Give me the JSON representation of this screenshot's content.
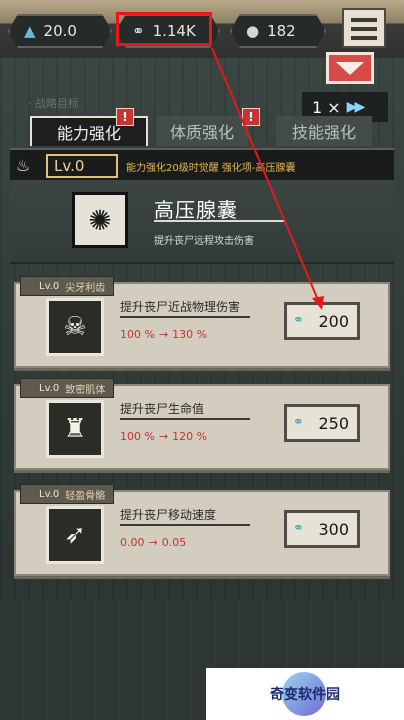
{
  "resources": {
    "rock": {
      "icon": "rock-crystal-icon",
      "value": "20.0"
    },
    "gene": {
      "icon": "gene-icon",
      "value": "1.14K"
    },
    "orb": {
      "icon": "brain-icon",
      "value": "182"
    }
  },
  "speed": {
    "label": "1 ×",
    "icon": "fast-forward-icon"
  },
  "faint_label": "· 战略目标",
  "tabs": [
    {
      "label": "能力强化",
      "active": true,
      "alert": "!"
    },
    {
      "label": "体质强化",
      "active": false,
      "alert": "!"
    },
    {
      "label": "技能强化",
      "active": false
    }
  ],
  "level": {
    "label": "Lv.0",
    "desc": "能力强化20级时觉醒 强化项-高压腺囊"
  },
  "skill": {
    "name": "高压腺囊",
    "desc": "提升丧尸远程攻击伤害"
  },
  "cards": [
    {
      "lv": "Lv.0",
      "name": "尖牙利齿",
      "desc": "提升丧尸近战物理伤害",
      "from": "100 %",
      "to": "130 %",
      "cost": "200",
      "icon": "skull-icon"
    },
    {
      "lv": "Lv.0",
      "name": "致密肌体",
      "desc": "提升丧尸生命值",
      "from": "100 %",
      "to": "120 %",
      "cost": "250",
      "icon": "muscle-torso-icon"
    },
    {
      "lv": "Lv.0",
      "name": "轻盈骨骼",
      "desc": "提升丧尸移动速度",
      "from": "0.00",
      "to": "0.05",
      "cost": "300",
      "icon": "foot-icon"
    }
  ],
  "watermark": "奇变软件园",
  "colors": {
    "highlight": "#e8181a",
    "accent_gold": "#e2b654",
    "dropdown": "#d84a48"
  }
}
